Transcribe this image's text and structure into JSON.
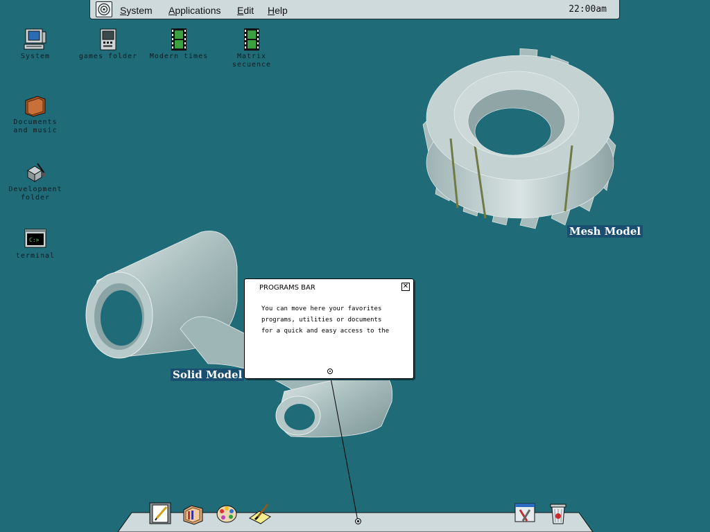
{
  "menubar": {
    "items": [
      "System",
      "Applications",
      "Edit",
      "Help"
    ],
    "clock": "22:00am"
  },
  "desktop": {
    "icons": [
      {
        "label": "System",
        "icon": "computer-icon"
      },
      {
        "label": "games folder",
        "icon": "gamepad-icon"
      },
      {
        "label": "Modern times",
        "icon": "film-icon"
      },
      {
        "label": "Matrix\nsecuence",
        "icon": "film-icon"
      },
      {
        "label": "Documents\nand music",
        "icon": "folder-icon"
      },
      {
        "label": "Development\nfolder",
        "icon": "tools-icon"
      },
      {
        "label": "terminal",
        "icon": "terminal-icon"
      }
    ]
  },
  "models": {
    "mesh_label": "Mesh Model",
    "solid_label": "Solid Model"
  },
  "popup": {
    "title": "PROGRAMS BAR",
    "close": "✕",
    "lines": [
      "You can move here your favorites",
      "programs, utilities or documents",
      "for a quick and easy access to the"
    ]
  },
  "dock": {
    "left_items": [
      "notepad-icon",
      "folder-icon",
      "palette-icon",
      "paint-icon"
    ],
    "right_items": [
      "settings-icon",
      "trash-icon"
    ]
  },
  "colors": {
    "desktop": "#1f6b78",
    "menubar": "#cfdadd",
    "label_bg": "#1a4f70"
  }
}
